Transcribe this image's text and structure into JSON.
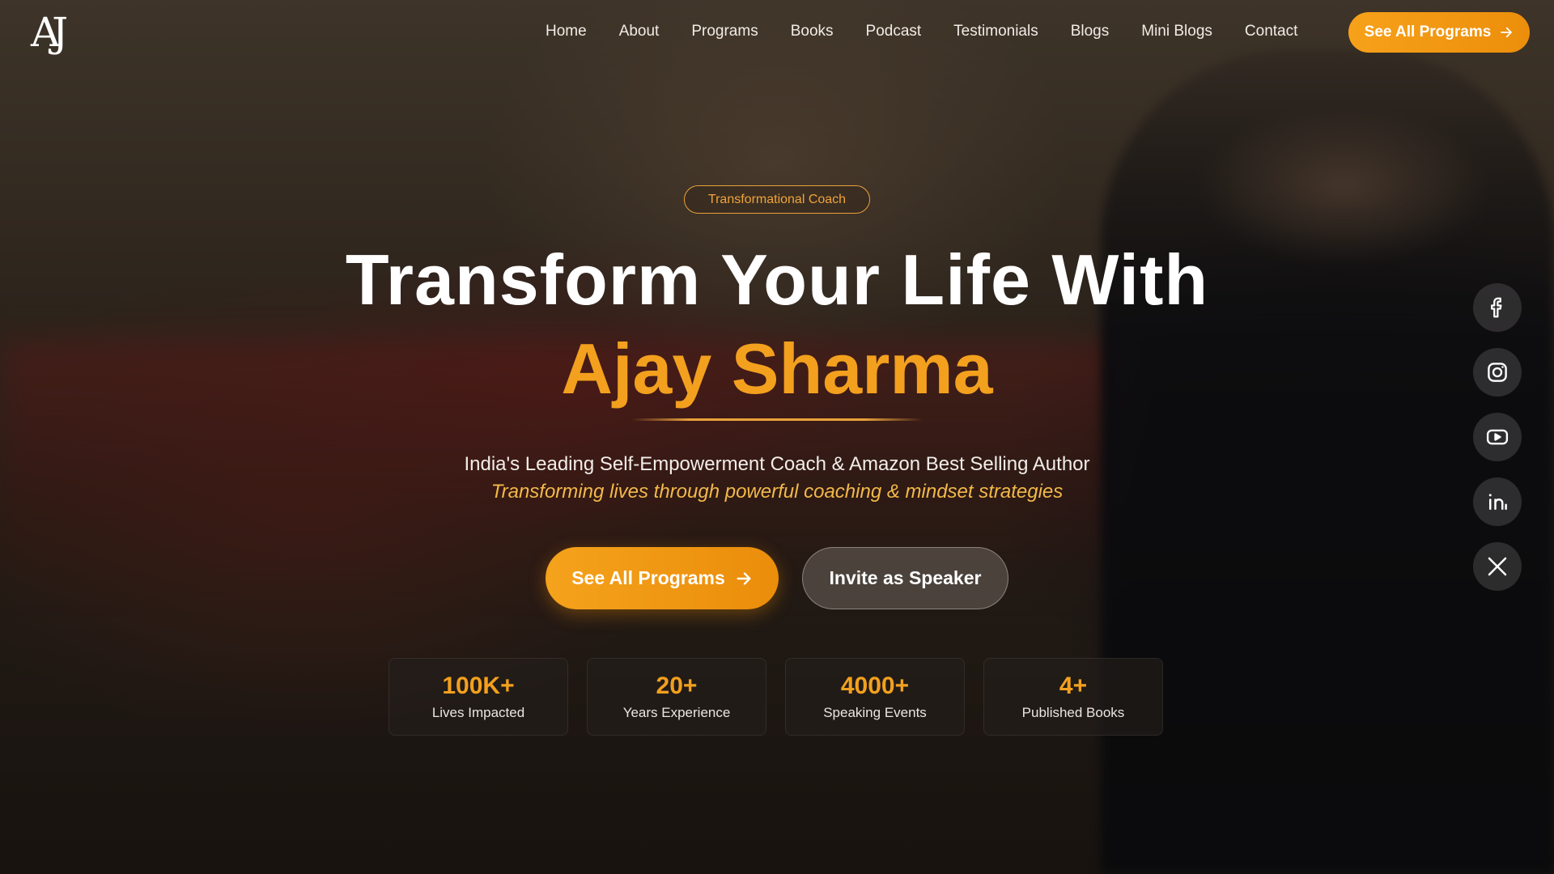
{
  "brand": {
    "logo_text": "AJ"
  },
  "nav": {
    "items": [
      {
        "label": "Home"
      },
      {
        "label": "About"
      },
      {
        "label": "Programs"
      },
      {
        "label": "Books"
      },
      {
        "label": "Podcast"
      },
      {
        "label": "Testimonials"
      },
      {
        "label": "Blogs"
      },
      {
        "label": "Mini Blogs"
      },
      {
        "label": "Contact"
      }
    ],
    "cta_label": "See All Programs",
    "cta_icon": "arrow-right-icon"
  },
  "hero": {
    "badge": "Transformational Coach",
    "title_line1": "Transform Your Life With",
    "title_line2": "Ajay Sharma",
    "tagline": "India's Leading Self-Empowerment Coach & Amazon Best Selling Author",
    "subline": "Transforming lives through powerful coaching & mindset strategies",
    "primary_button": "See All Programs",
    "secondary_button": "Invite as Speaker"
  },
  "stats": [
    {
      "value": "100K+",
      "label": "Lives Impacted"
    },
    {
      "value": "20+",
      "label": "Years Experience"
    },
    {
      "value": "4000+",
      "label": "Speaking Events"
    },
    {
      "value": "4+",
      "label": "Published Books"
    }
  ],
  "socials": [
    {
      "icon": "facebook-icon"
    },
    {
      "icon": "instagram-icon"
    },
    {
      "icon": "youtube-icon"
    },
    {
      "icon": "linkedin-icon"
    },
    {
      "icon": "x-twitter-icon"
    }
  ],
  "colors": {
    "accent": "#F3A01E",
    "accent_dark": "#EA8D0B",
    "text": "#FFFFFF"
  }
}
